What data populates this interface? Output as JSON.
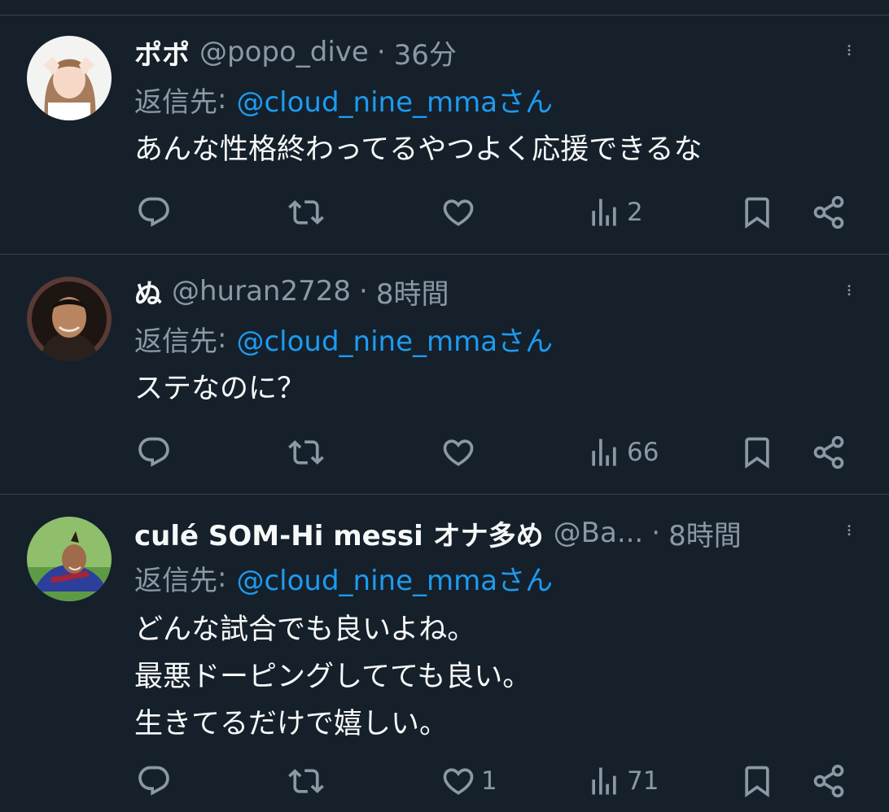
{
  "tweets": [
    {
      "display_name": "ポポ",
      "handle": "@popo_dive",
      "separator": "·",
      "time": "36分",
      "reply_prefix": "返信先",
      "reply_colon": ":",
      "reply_target": "@cloud_nine_mmaさん",
      "text": "あんな性格終わってるやつよく応援できるな",
      "like_count": "",
      "view_count": "2"
    },
    {
      "display_name": "ぬ",
      "handle": "@huran2728",
      "separator": "·",
      "time": "8時間",
      "reply_prefix": "返信先",
      "reply_colon": ":",
      "reply_target": "@cloud_nine_mmaさん",
      "text": "ステなのに？",
      "like_count": "",
      "view_count": "66"
    },
    {
      "display_name": "culé SOM-Hi messi オナ多め",
      "handle": "@Ba...",
      "separator": "·",
      "time": "8時間",
      "reply_prefix": "返信先",
      "reply_colon": ":",
      "reply_target": "@cloud_nine_mmaさん",
      "text": "どんな試合でも良いよね。\n最悪ドーピングしてても良い。\n生きてるだけで嬉しい。",
      "like_count": "1",
      "view_count": "71"
    }
  ],
  "colors": {
    "background": "#15202b",
    "divider": "#38444d",
    "secondary_text": "#8b98a5",
    "link": "#1d9bf0"
  },
  "icons": {
    "reply": "speech-bubble-icon",
    "retweet": "retweet-arrows-icon",
    "like": "heart-icon",
    "views": "bar-chart-icon",
    "bookmark": "bookmark-icon",
    "share": "share-icon",
    "more": "vertical-dots-icon"
  }
}
